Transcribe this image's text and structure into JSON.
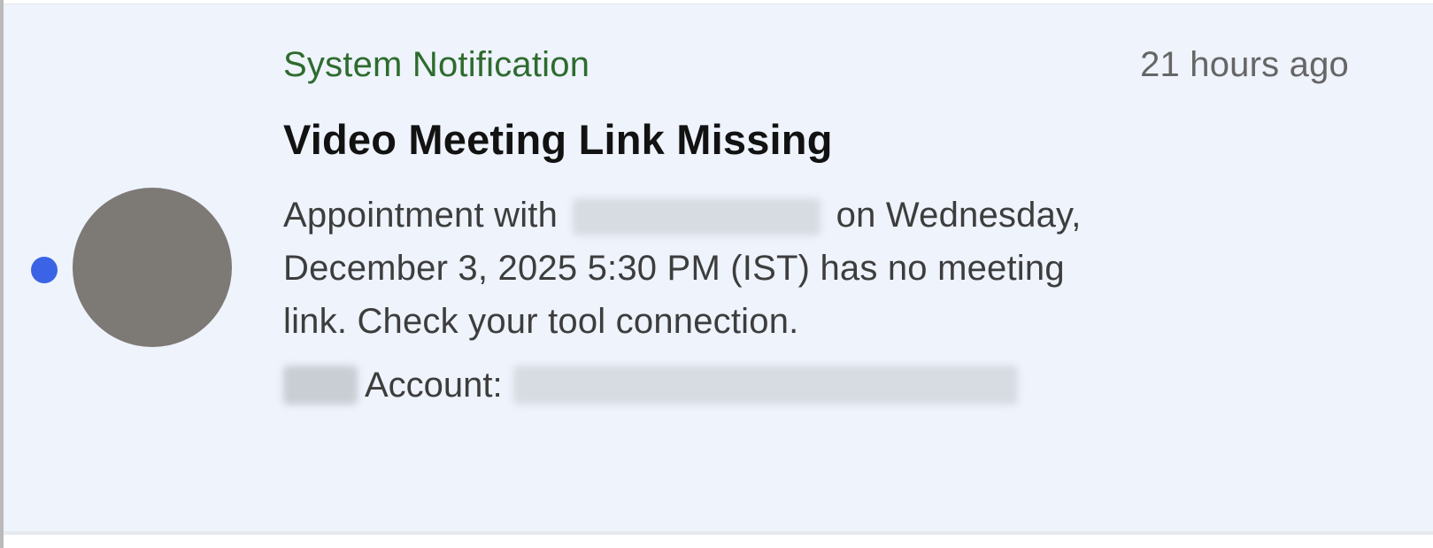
{
  "notification": {
    "source": "System Notification",
    "timestamp": "21 hours ago",
    "title": "Video Meeting Link Missing",
    "body_prefix": "Appointment with ",
    "body_on": " on",
    "body_rest": "Wednesday, December 3, 2025 5:30 PM (IST) has no meeting link. Check your tool connection.",
    "account_label": "Account:",
    "unread": true
  },
  "colors": {
    "card_background": "#eef3fc",
    "source_text": "#2e6b2e",
    "unread_dot": "#3b63e6",
    "avatar": "#7d7975"
  },
  "icons": {
    "unread_indicator": "unread-dot-icon",
    "avatar": "avatar"
  }
}
